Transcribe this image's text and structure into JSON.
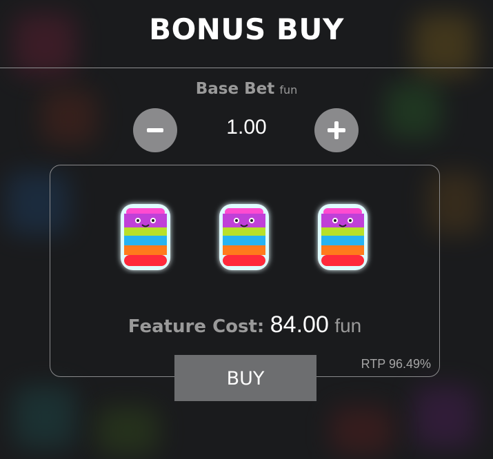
{
  "dialog": {
    "title": "BONUS BUY"
  },
  "base_bet": {
    "label": "Base Bet",
    "unit": "fun",
    "value": "1.00",
    "decrease_icon": "minus-icon",
    "increase_icon": "plus-icon"
  },
  "feature": {
    "symbols": [
      "rainbow-jar-icon",
      "rainbow-jar-icon",
      "rainbow-jar-icon"
    ],
    "cost_label": "Feature Cost:",
    "cost_value": "84.00",
    "cost_unit": "fun",
    "rtp": "RTP 96.49%"
  },
  "buy_button": {
    "label": "BUY"
  },
  "colors": {
    "background": "#1a1b1d",
    "button_gray": "#8a8a8c",
    "buy_gray": "#6d6e70",
    "label_gray": "#9a9a9a"
  }
}
